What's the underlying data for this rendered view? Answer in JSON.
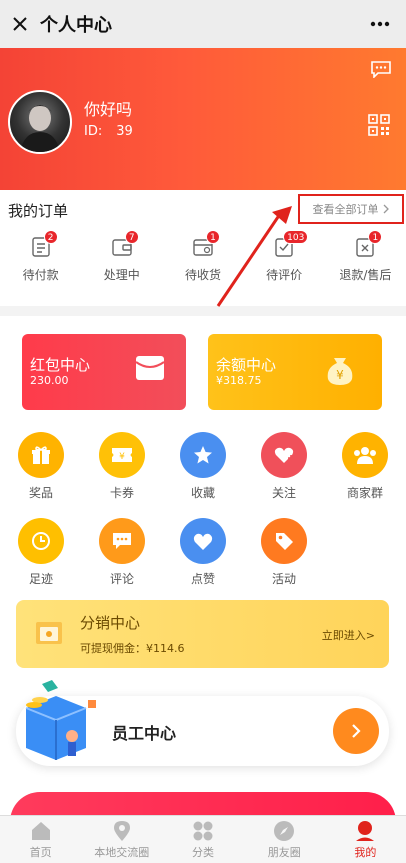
{
  "topbar": {
    "title": "个人中心"
  },
  "profile": {
    "nickname": "你好吗",
    "id_label": "ID:",
    "id_value": "39"
  },
  "orders": {
    "title": "我的订单",
    "view_all": "查看全部订单",
    "items": [
      {
        "label": "待付款",
        "badge": "2",
        "icon": "list-icon"
      },
      {
        "label": "处理中",
        "badge": "7",
        "icon": "wallet-icon"
      },
      {
        "label": "待收货",
        "badge": "1",
        "icon": "delivery-box-icon"
      },
      {
        "label": "待评价",
        "badge": "103",
        "icon": "review-icon"
      },
      {
        "label": "退款/售后",
        "badge": "1",
        "icon": "refund-icon"
      }
    ]
  },
  "cards": {
    "red": {
      "title": "红包中心",
      "value": "230.00"
    },
    "yellow": {
      "title": "余额中心",
      "value": "¥318.75",
      "icon_char": "¥"
    }
  },
  "grid": {
    "items": [
      {
        "label": "奖品",
        "icon": "gift-icon"
      },
      {
        "label": "卡券",
        "icon": "coupon-icon",
        "icon_char": "¥"
      },
      {
        "label": "收藏",
        "icon": "star-icon"
      },
      {
        "label": "关注",
        "icon": "heart-plus-icon"
      },
      {
        "label": "商家群",
        "icon": "group-icon"
      },
      {
        "label": "足迹",
        "icon": "clock-icon"
      },
      {
        "label": "评论",
        "icon": "comment-icon"
      },
      {
        "label": "点赞",
        "icon": "like-icon"
      },
      {
        "label": "活动",
        "icon": "tag-icon"
      }
    ]
  },
  "distribution": {
    "title": "分销中心",
    "subtitle": "可提现佣金：¥114.6",
    "link": "立即进入>"
  },
  "staff": {
    "title": "员工中心"
  },
  "tabbar": {
    "items": [
      {
        "label": "首页"
      },
      {
        "label": "本地交流圈"
      },
      {
        "label": "分类"
      },
      {
        "label": "朋友圈"
      },
      {
        "label": "我的"
      }
    ]
  },
  "colors": {
    "primary_red": "#e0231c",
    "hero_start": "#f44336",
    "hero_end": "#ff7a2f",
    "gold": "#ffc21a"
  }
}
